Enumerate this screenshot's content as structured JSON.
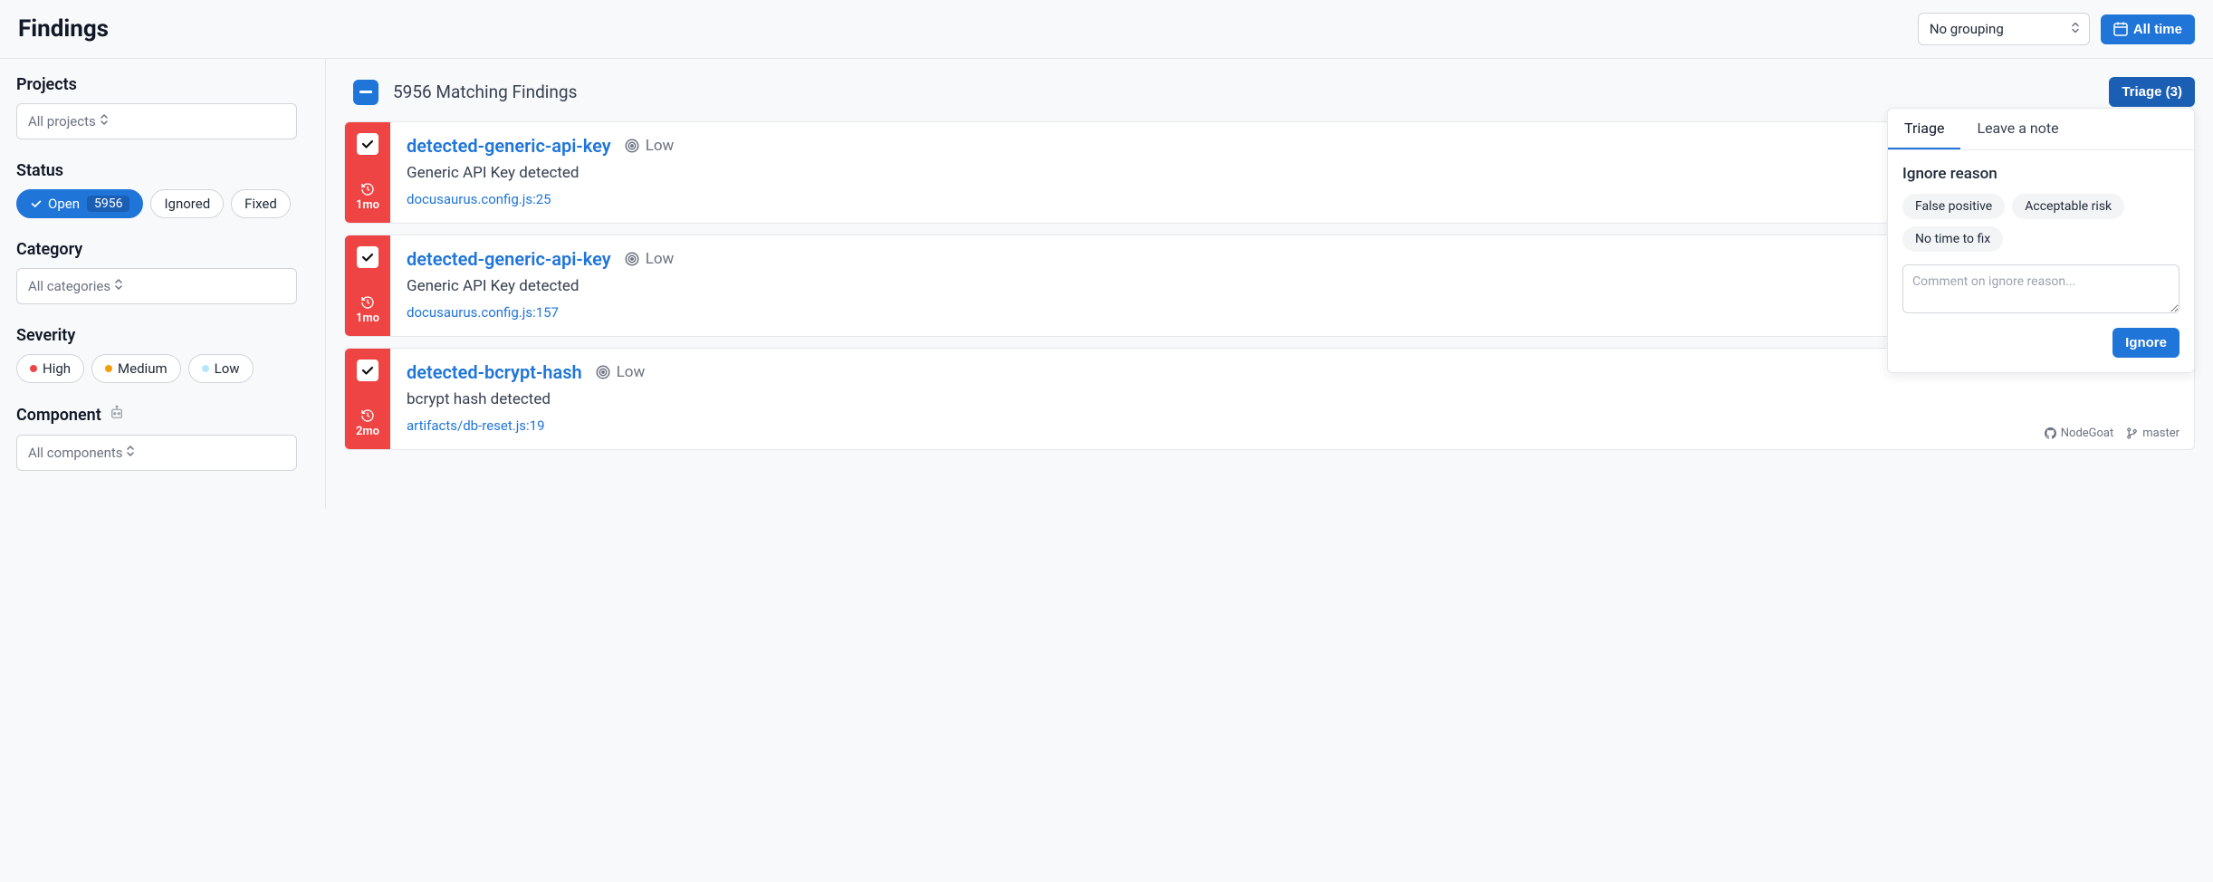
{
  "header": {
    "title": "Findings",
    "grouping_label": "No grouping",
    "time_label": "All time"
  },
  "sidebar": {
    "projects": {
      "heading": "Projects",
      "placeholder": "All projects"
    },
    "status": {
      "heading": "Status",
      "open_label": "Open",
      "open_count": "5956",
      "ignored_label": "Ignored",
      "fixed_label": "Fixed"
    },
    "category": {
      "heading": "Category",
      "placeholder": "All categories"
    },
    "severity": {
      "heading": "Severity",
      "high": "High",
      "medium": "Medium",
      "low": "Low"
    },
    "component": {
      "heading": "Component",
      "placeholder": "All components"
    }
  },
  "summary": {
    "count_text": "5956 Matching Findings",
    "triage_button": "Triage (3)"
  },
  "findings": [
    {
      "title": "detected-generic-api-key",
      "severity": "Low",
      "description": "Generic API Key detected",
      "location": "docusaurus.config.js:25",
      "age": "1mo"
    },
    {
      "title": "detected-generic-api-key",
      "severity": "Low",
      "description": "Generic API Key detected",
      "location": "docusaurus.config.js:157",
      "age": "1mo"
    },
    {
      "title": "detected-bcrypt-hash",
      "severity": "Low",
      "description": "bcrypt hash detected",
      "location": "artifacts/db-reset.js:19",
      "age": "2mo",
      "repo": "NodeGoat",
      "branch": "master"
    }
  ],
  "triage_panel": {
    "tab_triage": "Triage",
    "tab_note": "Leave a note",
    "ignore_heading": "Ignore reason",
    "reasons": {
      "r0": "False positive",
      "r1": "Acceptable risk",
      "r2": "No time to fix"
    },
    "comment_placeholder": "Comment on ignore reason...",
    "ignore_button": "Ignore"
  }
}
